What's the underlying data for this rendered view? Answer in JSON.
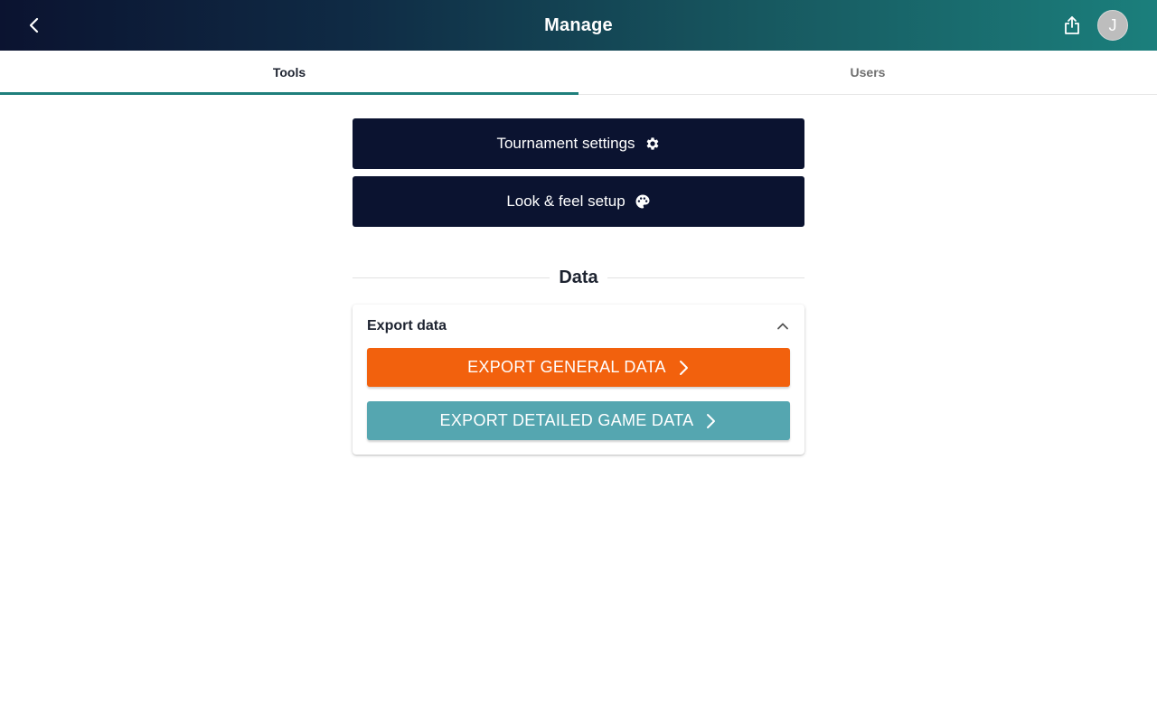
{
  "header": {
    "title": "Manage",
    "back_icon": "chevron-left-icon",
    "share_icon": "share-icon",
    "avatar_initial": "J"
  },
  "tabs": [
    {
      "label": "Tools",
      "active": true
    },
    {
      "label": "Users",
      "active": false
    }
  ],
  "tools": {
    "tournament_settings_label": "Tournament settings",
    "tournament_settings_icon": "gear-icon",
    "look_feel_label": "Look & feel setup",
    "look_feel_icon": "palette-icon"
  },
  "data_section": {
    "heading": "Data",
    "card": {
      "title": "Export data",
      "expanded": true,
      "buttons": [
        {
          "label": "EXPORT GENERAL DATA",
          "color": "#f2610d"
        },
        {
          "label": "EXPORT DETAILED GAME DATA",
          "color": "#55a6b0"
        }
      ]
    }
  },
  "colors": {
    "header_gradient_start": "#0b1330",
    "header_gradient_end": "#1b7f7c",
    "dark_button": "#0b1330",
    "tab_indicator": "#1f7f7c"
  }
}
